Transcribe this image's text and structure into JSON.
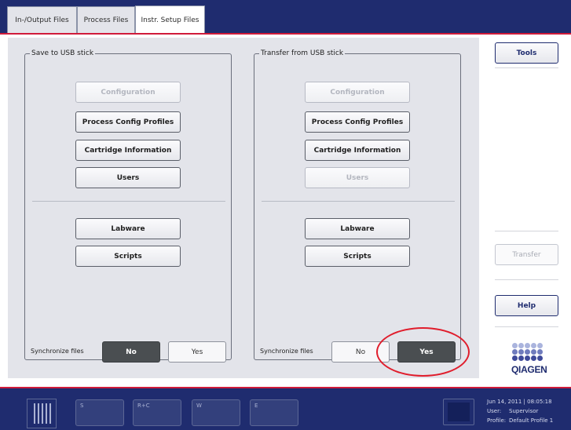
{
  "tabs": [
    {
      "label": "In-/Output Files",
      "active": false
    },
    {
      "label": "Process Files",
      "active": false
    },
    {
      "label": "Instr. Setup Files",
      "active": true
    }
  ],
  "save_group": {
    "title": "Save to USB stick",
    "buttons": [
      {
        "label": "Configuration",
        "enabled": false
      },
      {
        "label": "Process Config Profiles",
        "enabled": true
      },
      {
        "label": "Cartridge Information",
        "enabled": true
      },
      {
        "label": "Users",
        "enabled": true
      },
      {
        "label": "Labware",
        "enabled": true
      },
      {
        "label": "Scripts",
        "enabled": true
      }
    ],
    "sync_label": "Synchronize files",
    "sync_no": "No",
    "sync_yes": "Yes",
    "sync_selected": "No"
  },
  "transfer_group": {
    "title": "Transfer from USB stick",
    "buttons": [
      {
        "label": "Configuration",
        "enabled": false
      },
      {
        "label": "Process Config Profiles",
        "enabled": true
      },
      {
        "label": "Cartridge Information",
        "enabled": true
      },
      {
        "label": "Users",
        "enabled": false
      },
      {
        "label": "Labware",
        "enabled": true
      },
      {
        "label": "Scripts",
        "enabled": true
      }
    ],
    "sync_label": "Synchronize files",
    "sync_no": "No",
    "sync_yes": "Yes",
    "sync_selected": "Yes"
  },
  "right_panel": {
    "tools_label": "Tools",
    "transfer_label": "Transfer",
    "transfer_enabled": false,
    "help_label": "Help",
    "logo_text": "QIAGEN"
  },
  "bottom_bar": {
    "slots": [
      "S",
      "R+C",
      "W",
      "E"
    ],
    "datetime": "Jun 14, 2011 | 08:05:18",
    "user_key": "User:",
    "user_value": "Supervisor",
    "profile_key": "Profile:",
    "profile_value": "Default Profile 1"
  },
  "colors": {
    "navy": "#1f2c6f",
    "accent_red": "#d01b3a",
    "annotation_red": "#e01d2c",
    "panel_gray": "#e3e4ea",
    "toggle_dark": "#4a4e51",
    "logo_dot_light": "#aab4dd",
    "logo_dot_dark": "#3f4a9a"
  },
  "icons": {
    "rack": "rack-icon",
    "square": "square-slot-icon",
    "logo": "qiagen-logo"
  }
}
